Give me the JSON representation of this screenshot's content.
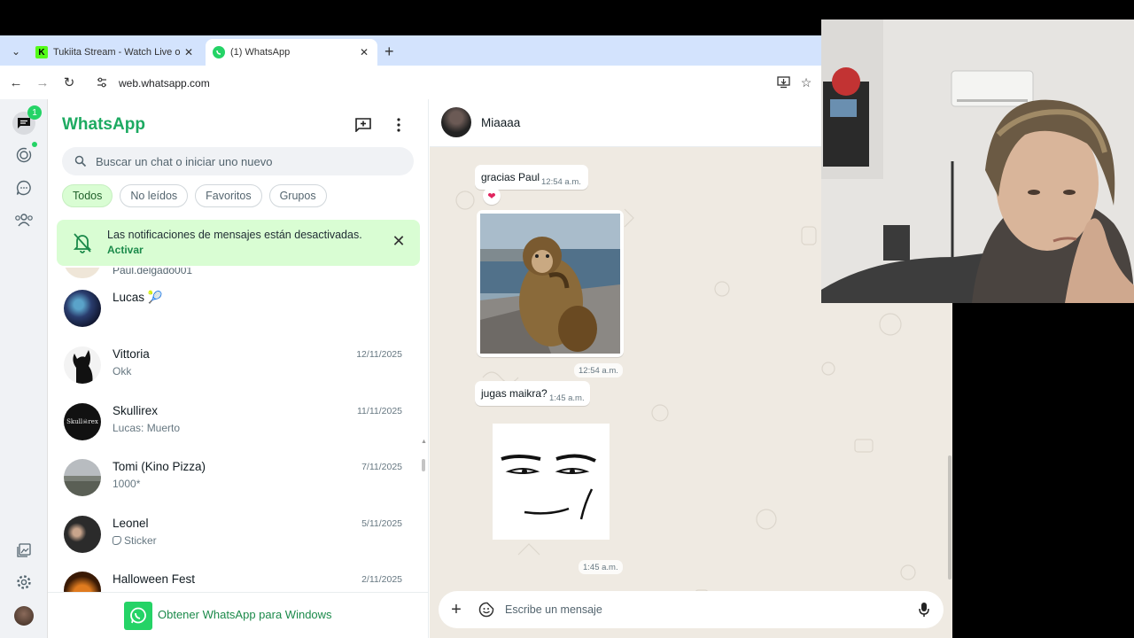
{
  "browser": {
    "tabs": [
      {
        "title": "Tukiita Stream - Watch Live on",
        "active": false
      },
      {
        "title": "(1) WhatsApp",
        "active": true
      }
    ],
    "url": "web.whatsapp.com"
  },
  "rail": {
    "unread_badge": "1"
  },
  "sidebar": {
    "title": "WhatsApp",
    "search_placeholder": "Buscar un chat o iniciar uno nuevo",
    "filters": [
      "Todos",
      "No leídos",
      "Favoritos",
      "Grupos"
    ],
    "active_filter": "Todos",
    "notification": {
      "text": "Las notificaciones de mensajes están desactivadas.",
      "action": "Activar"
    },
    "partial_preview": "Paul.delgado001",
    "chats": [
      {
        "name": "Lucas",
        "emoji": "🎾",
        "preview": "",
        "date": ""
      },
      {
        "name": "Vittoria",
        "preview": "Okk",
        "date": "12/11/2025"
      },
      {
        "name": "Skullirex",
        "preview": "Lucas: Muerto",
        "date": "11/11/2025"
      },
      {
        "name": "Tomi (Kino Pizza)",
        "preview": "1000*",
        "date": "7/11/2025"
      },
      {
        "name": "Leonel",
        "preview": "Sticker",
        "date": "5/11/2025"
      },
      {
        "name": "Halloween Fest",
        "preview": "",
        "date": "2/11/2025"
      }
    ],
    "get_app_label": "Obtener WhatsApp para Windows"
  },
  "conversation": {
    "contact_name": "Miaaaa",
    "messages": [
      {
        "type": "text",
        "text": "gracias Paul",
        "time": "12:54 a.m.",
        "reaction": "❤"
      },
      {
        "type": "image",
        "alt": "monkey",
        "time": "12:54 a.m."
      },
      {
        "type": "text",
        "text": "jugas maikra?",
        "time": "1:45 a.m."
      },
      {
        "type": "sticker",
        "alt": "face",
        "time": "1:45 a.m."
      }
    ],
    "composer_placeholder": "Escribe un mensaje"
  },
  "colors": {
    "brand": "#1daa61",
    "chip_active": "#d9fdd3",
    "chat_bg": "#efeae2",
    "tabstrip": "#d3e3fd"
  }
}
